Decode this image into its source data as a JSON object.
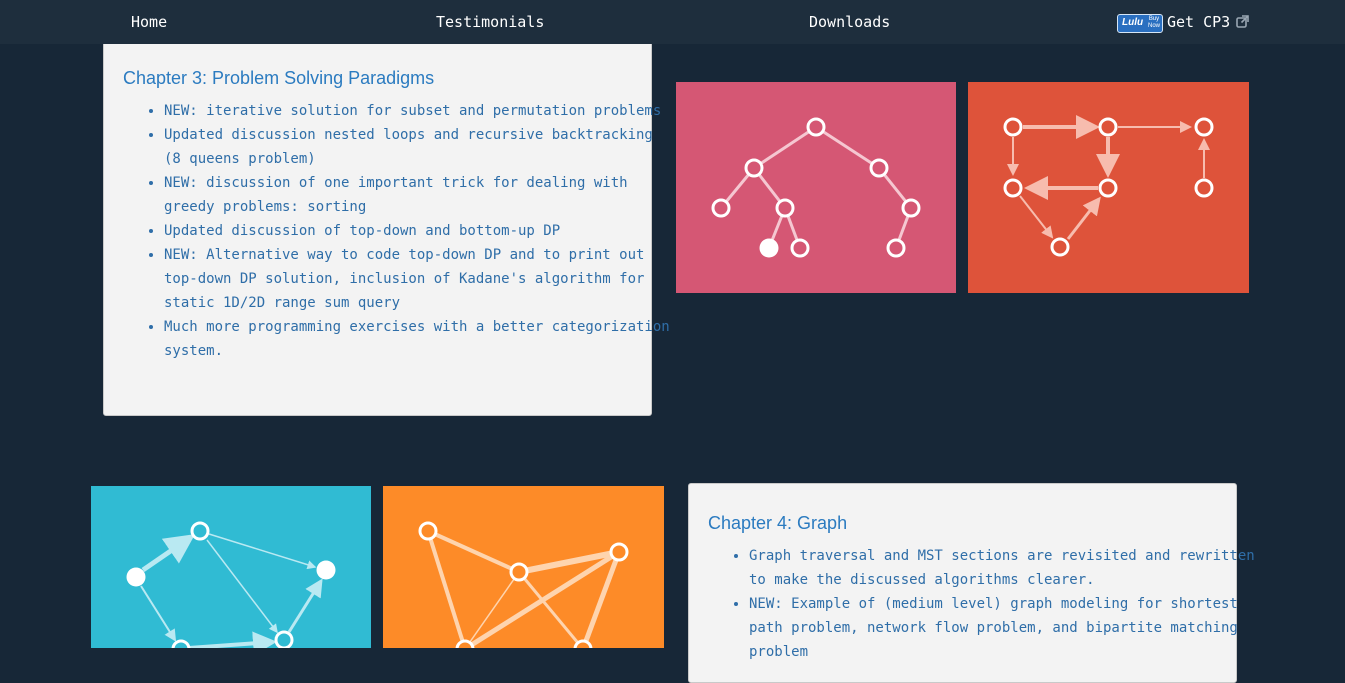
{
  "nav": {
    "home": "Home",
    "testimonials": "Testimonials",
    "downloads": "Downloads",
    "lulu_badge": "Lulu",
    "lulu_buy_now": "Buy Now",
    "get_cp3": "Get CP3"
  },
  "chapter3": {
    "title": "Chapter 3: Problem Solving Paradigms",
    "items": [
      "NEW: iterative solution for subset and permutation problems",
      "Updated discussion nested loops and recursive backtracking (8 queens problem)",
      "NEW: discussion of one important trick for dealing with greedy problems: sorting",
      "Updated discussion of top-down and bottom-up DP",
      "NEW: Alternative way to code top-down DP and to print out top-down DP solution, inclusion of Kadane's algorithm for static 1D/2D range sum query",
      "Much more programming exercises with a better categorization system."
    ]
  },
  "chapter4": {
    "title": "Chapter 4: Graph",
    "items": [
      "Graph traversal and MST sections are revisited and rewritten to make the discussed algorithms clearer.",
      "NEW: Example of (medium level) graph modeling for shortest path problem, network flow problem, and bipartite matching problem"
    ]
  },
  "colors": {
    "background": "#172737",
    "navbar": "#1e2e3d",
    "tile_pink": "#d55774",
    "tile_red": "#de533a",
    "tile_cyan": "#30bbd3",
    "tile_orange": "#fd8b28",
    "card_text": "#2b7bc0"
  }
}
